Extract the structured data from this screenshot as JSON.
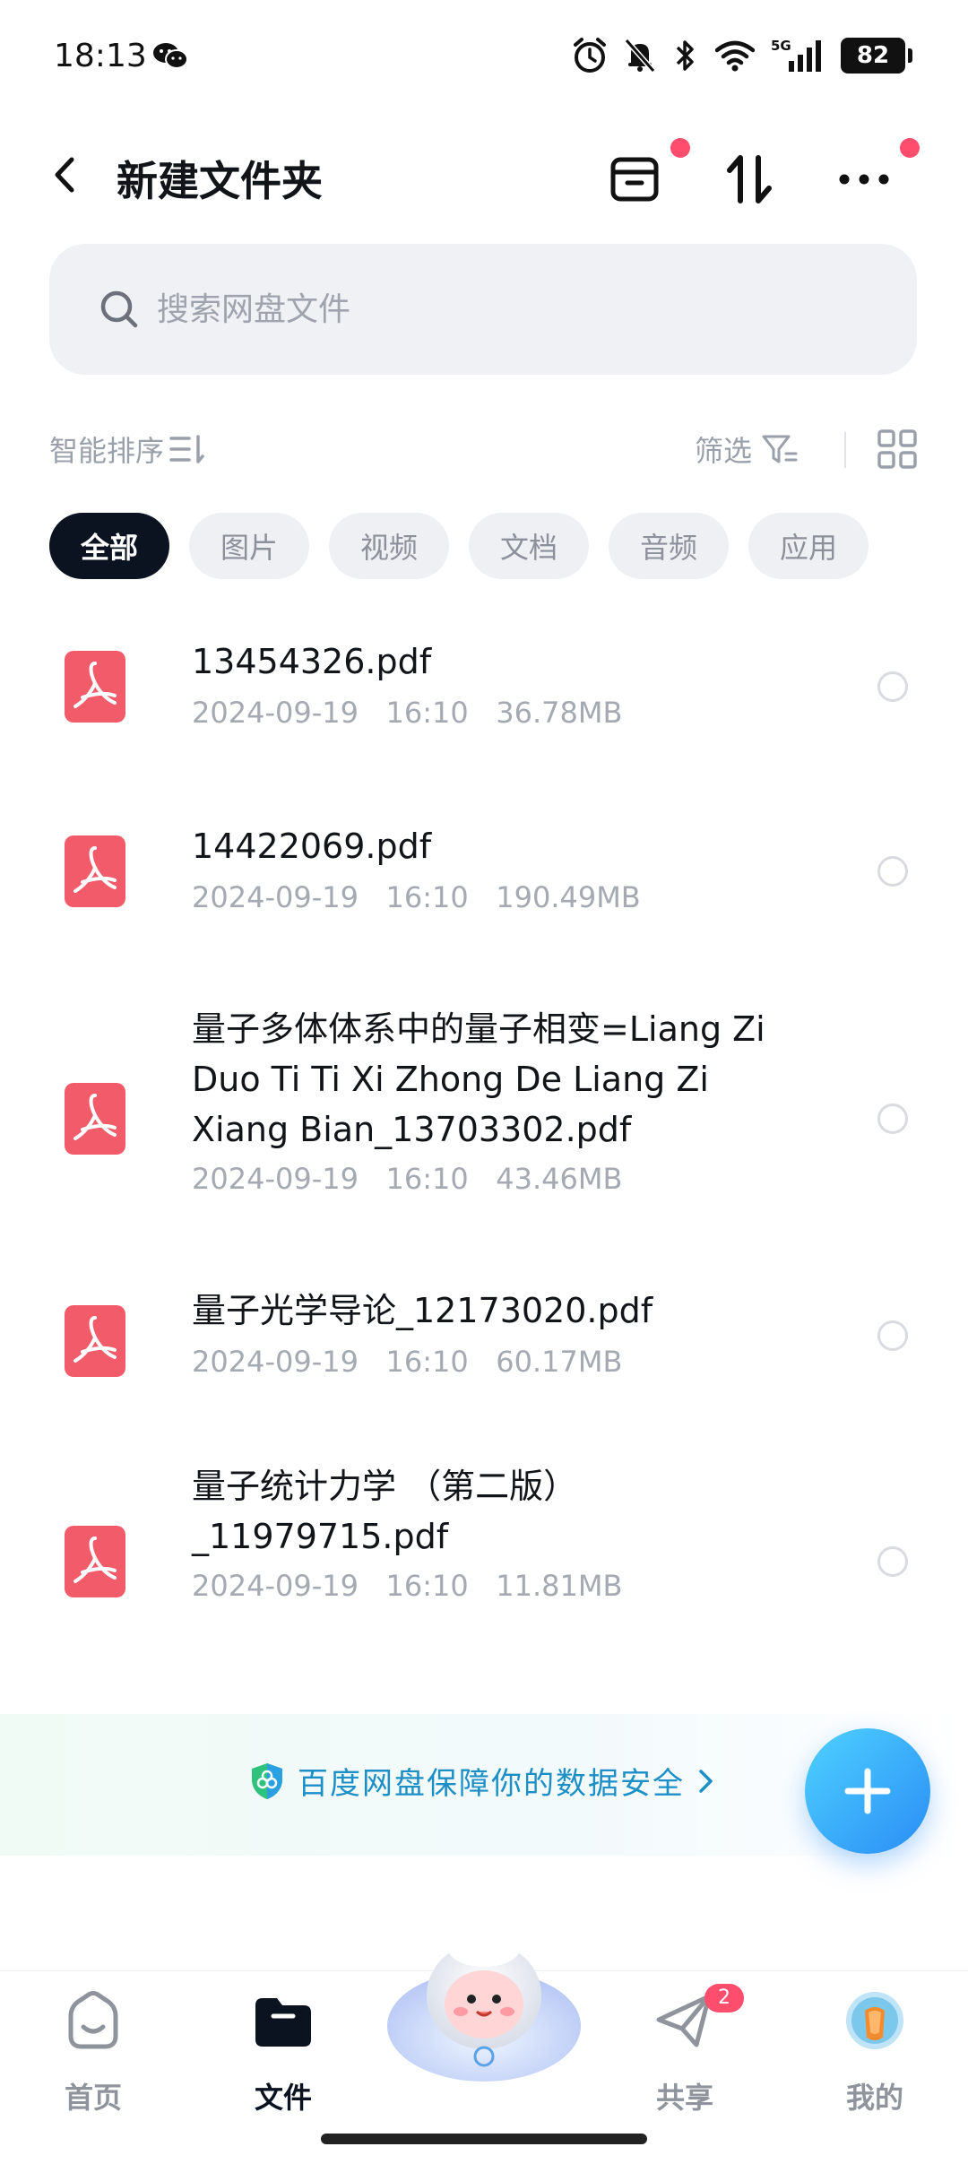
{
  "status_bar": {
    "time": "18:13",
    "battery": "82",
    "network": "5G"
  },
  "header": {
    "title": "新建文件夹"
  },
  "search": {
    "placeholder": "搜索网盘文件"
  },
  "toolbar": {
    "smart_sort_label": "智能排序",
    "filter_label": "筛选"
  },
  "categories": [
    {
      "label": "全部",
      "active": true
    },
    {
      "label": "图片",
      "active": false
    },
    {
      "label": "视频",
      "active": false
    },
    {
      "label": "文档",
      "active": false
    },
    {
      "label": "音频",
      "active": false
    },
    {
      "label": "应用",
      "active": false
    }
  ],
  "files": [
    {
      "name": "13454326.pdf",
      "date": "2024-09-19",
      "time": "16:10",
      "size": "36.78MB"
    },
    {
      "name": "14422069.pdf",
      "date": "2024-09-19",
      "time": "16:10",
      "size": "190.49MB"
    },
    {
      "name": "量子多体体系中的量子相变=Liang Zi Duo Ti Ti Xi Zhong De Liang Zi Xiang Bian_13703302.pdf",
      "date": "2024-09-19",
      "time": "16:10",
      "size": "43.46MB"
    },
    {
      "name": "量子光学导论_12173020.pdf",
      "date": "2024-09-19",
      "time": "16:10",
      "size": "60.17MB"
    },
    {
      "name": "量子统计力学 （第二版）_11979715.pdf",
      "date": "2024-09-19",
      "time": "16:10",
      "size": "11.81MB"
    }
  ],
  "security_banner": {
    "text": "百度网盘保障你的数据安全"
  },
  "bottom_nav": {
    "home": "首页",
    "files": "文件",
    "share": "共享",
    "me": "我的",
    "share_badge": "2"
  },
  "colors": {
    "accent": "#2a8cf5",
    "active_chip": "#0b1320",
    "pdf_red": "#f25b6a",
    "badge_red": "#ff4d6d",
    "security_text": "#1c8fc7"
  }
}
